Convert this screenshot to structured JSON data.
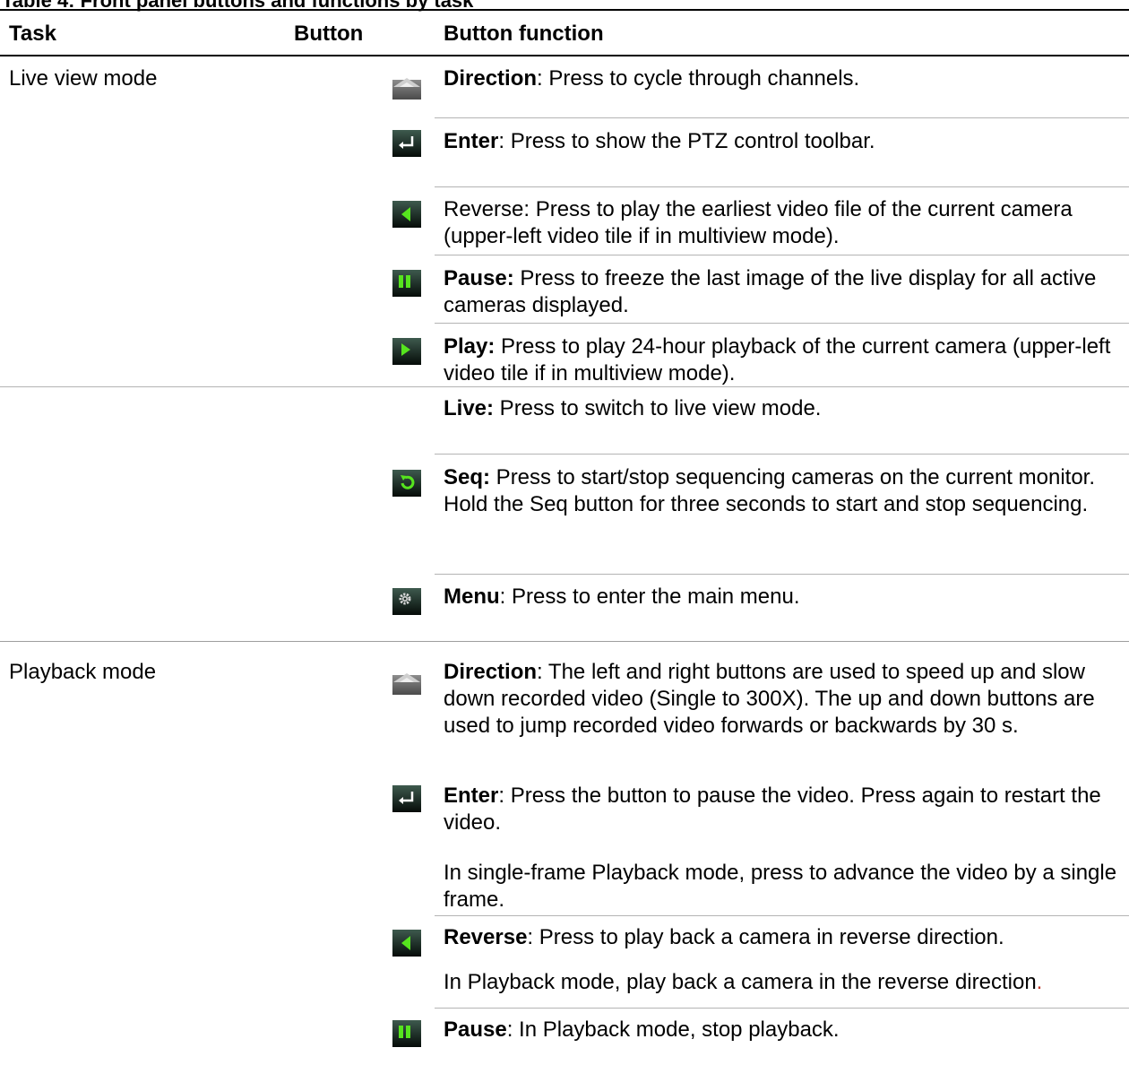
{
  "table": {
    "headers": {
      "task": "Task",
      "button": "Button",
      "function": "Button function"
    }
  },
  "live": {
    "task": "Live view mode",
    "items": [
      {
        "icon": "direction-arrow-icon",
        "name": "Direction",
        "desc": ":  Press to cycle through channels."
      },
      {
        "icon": "enter-icon",
        "name": "Enter",
        "desc": ": Press to show the PTZ control toolbar."
      },
      {
        "icon": "reverse-icon",
        "name": "",
        "desc": "Reverse: Press to play the earliest video file of the current camera (upper-left video tile if in multiview mode)."
      },
      {
        "icon": "pause-icon",
        "name": "Pause:",
        "desc": " Press to freeze the last image of the live display for all active cameras displayed."
      },
      {
        "icon": "play-icon",
        "name": "Play:",
        "desc": " Press to play 24-hour playback of the current camera (upper-left video tile if in multiview mode)."
      },
      {
        "icon": "",
        "name": "Live:",
        "desc": " Press to switch to live view mode."
      },
      {
        "icon": "sequence-icon",
        "name": "Seq:",
        "desc": " Press to start/stop sequencing cameras on the current monitor. Hold the Seq button for three seconds to start and stop sequencing."
      },
      {
        "icon": "menu-gear-icon",
        "name": "Menu",
        "desc": ": Press to enter the main menu."
      }
    ]
  },
  "playback": {
    "task": "Playback mode",
    "items": [
      {
        "icon": "direction-arrow-icon",
        "name": "Direction",
        "desc": ": The left and right buttons are used to speed up and slow down recorded video (Single to 300X). The up and down buttons are used to jump recorded video forwards or backwards by 30 s."
      },
      {
        "icon": "enter-icon",
        "name": "Enter",
        "desc": ": Press the button to pause the video. Press again to restart the video.",
        "extra": "In single-frame Playback mode, press to advance the video by a single frame."
      },
      {
        "icon": "reverse-icon",
        "name": "Reverse",
        "desc": ": Press to play back a camera in reverse direction.",
        "extra": "In Playback mode, play back a camera in the reverse direction",
        "extra_end": "."
      },
      {
        "icon": "pause-icon",
        "name": "Pause",
        "desc": ": In Playback mode, stop playback."
      }
    ]
  },
  "colors": {
    "icon_dark": "#0c1a14",
    "icon_green": "#56e41e",
    "icon_grey": "#7a7a7a",
    "rule": "#b4b4b4"
  }
}
